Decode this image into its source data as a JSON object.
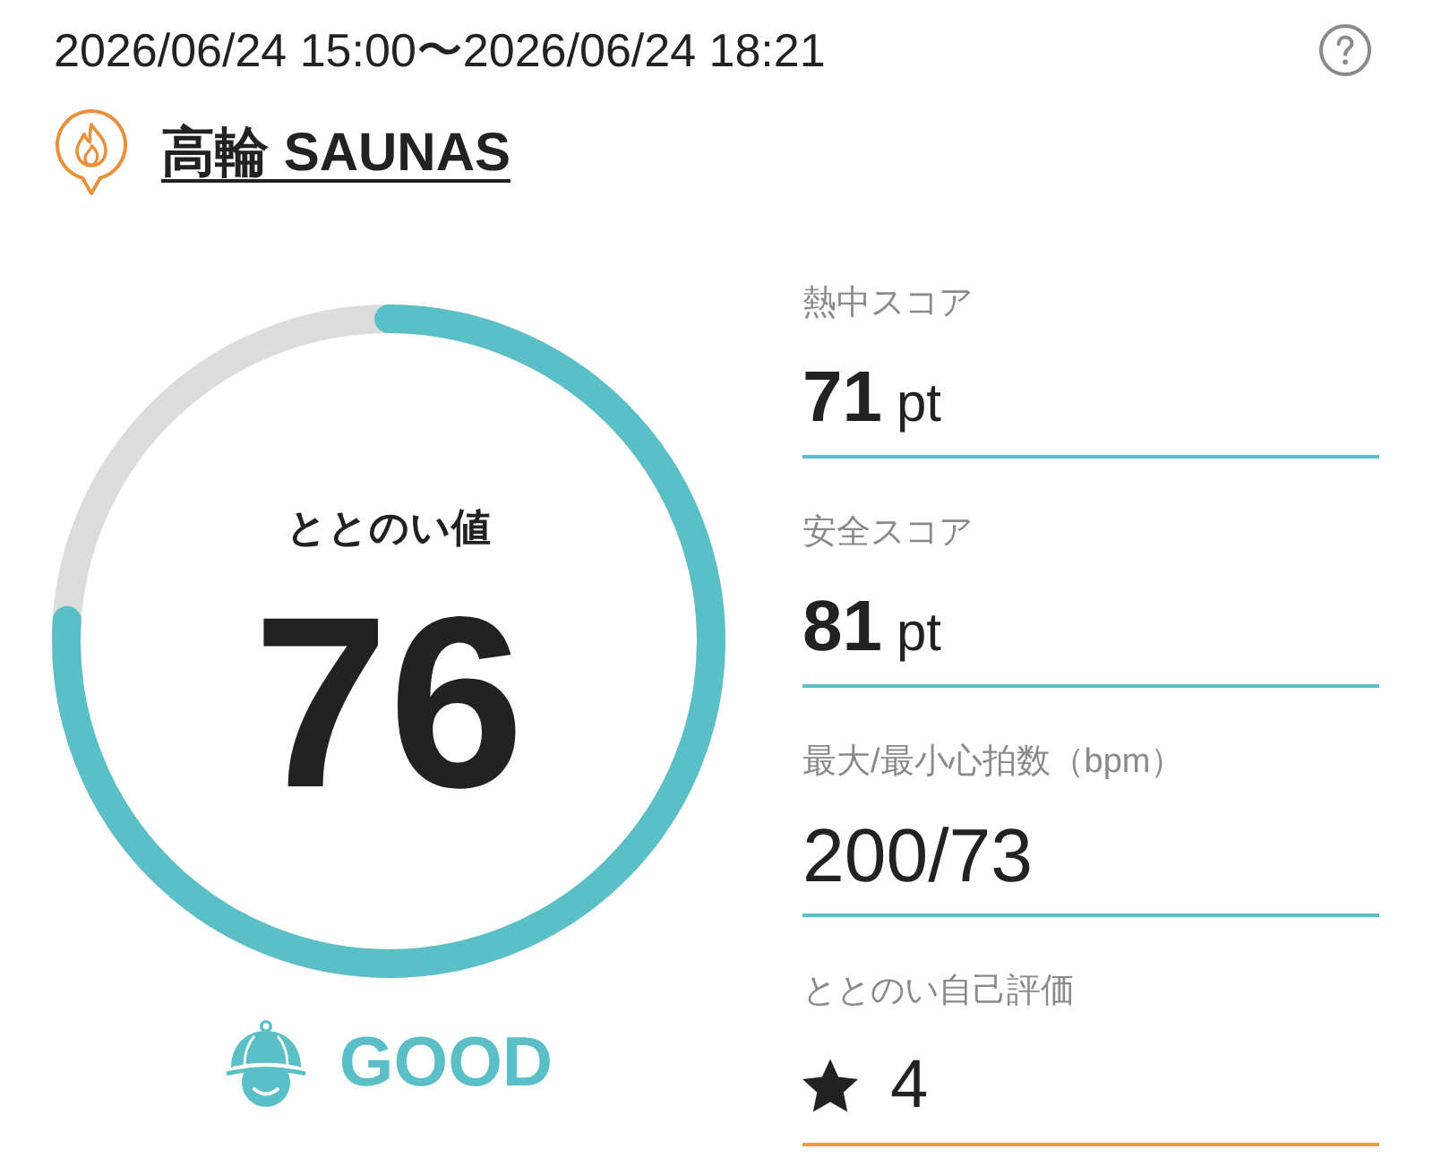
{
  "period": "2026/06/24 15:00〜2026/06/24 18:21",
  "venue": {
    "name": "高輪 SAUNAS"
  },
  "score": {
    "label": "ととのい値",
    "value": "76",
    "level": 0.76
  },
  "condition": {
    "label": "GOOD"
  },
  "metrics": [
    {
      "kind": "score",
      "label": "熱中スコア",
      "value": "71",
      "unit": "pt",
      "color": "#5bbfc7"
    },
    {
      "kind": "score",
      "label": "安全スコア",
      "value": "81",
      "unit": "pt",
      "color": "#5bbfc7"
    },
    {
      "kind": "plain",
      "label": "最大/最小心拍数（bpm）",
      "value": "200/73",
      "color": "#5bbfc7"
    },
    {
      "kind": "rating",
      "label": "ととのい自己評価",
      "value": "4",
      "color": "#ef9a4a"
    }
  ]
}
